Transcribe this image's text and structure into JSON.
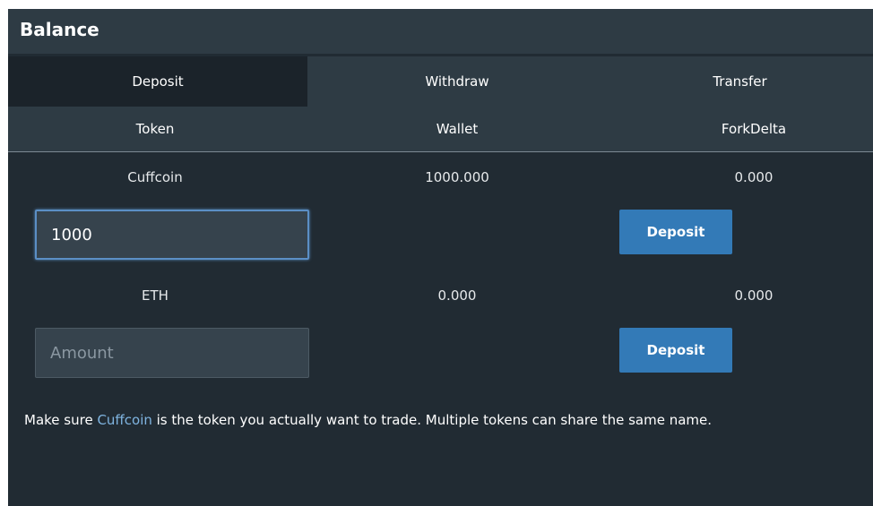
{
  "panel": {
    "title": "Balance"
  },
  "tabs": [
    {
      "label": "Deposit",
      "active": true
    },
    {
      "label": "Withdraw",
      "active": false
    },
    {
      "label": "Transfer",
      "active": false
    }
  ],
  "columns": {
    "token": "Token",
    "wallet": "Wallet",
    "exchange": "ForkDelta"
  },
  "rows": [
    {
      "token": "Cuffcoin",
      "wallet": "1000.000",
      "exchange": "0.000",
      "input_value": "1000",
      "input_placeholder": "Amount",
      "button_label": "Deposit"
    },
    {
      "token": "ETH",
      "wallet": "0.000",
      "exchange": "0.000",
      "input_value": "",
      "input_placeholder": "Amount",
      "button_label": "Deposit"
    }
  ],
  "notice": {
    "prefix": "Make sure ",
    "token": "Cuffcoin",
    "suffix": " is the token you actually want to trade. Multiple tokens can share the same name."
  },
  "colors": {
    "panel_bg": "#212b33",
    "header_bg": "#2e3b44",
    "active_tab_bg": "#1b232a",
    "button_bg": "#337ab7",
    "link": "#7fb4e0",
    "focus_border": "#5b8fc5"
  }
}
